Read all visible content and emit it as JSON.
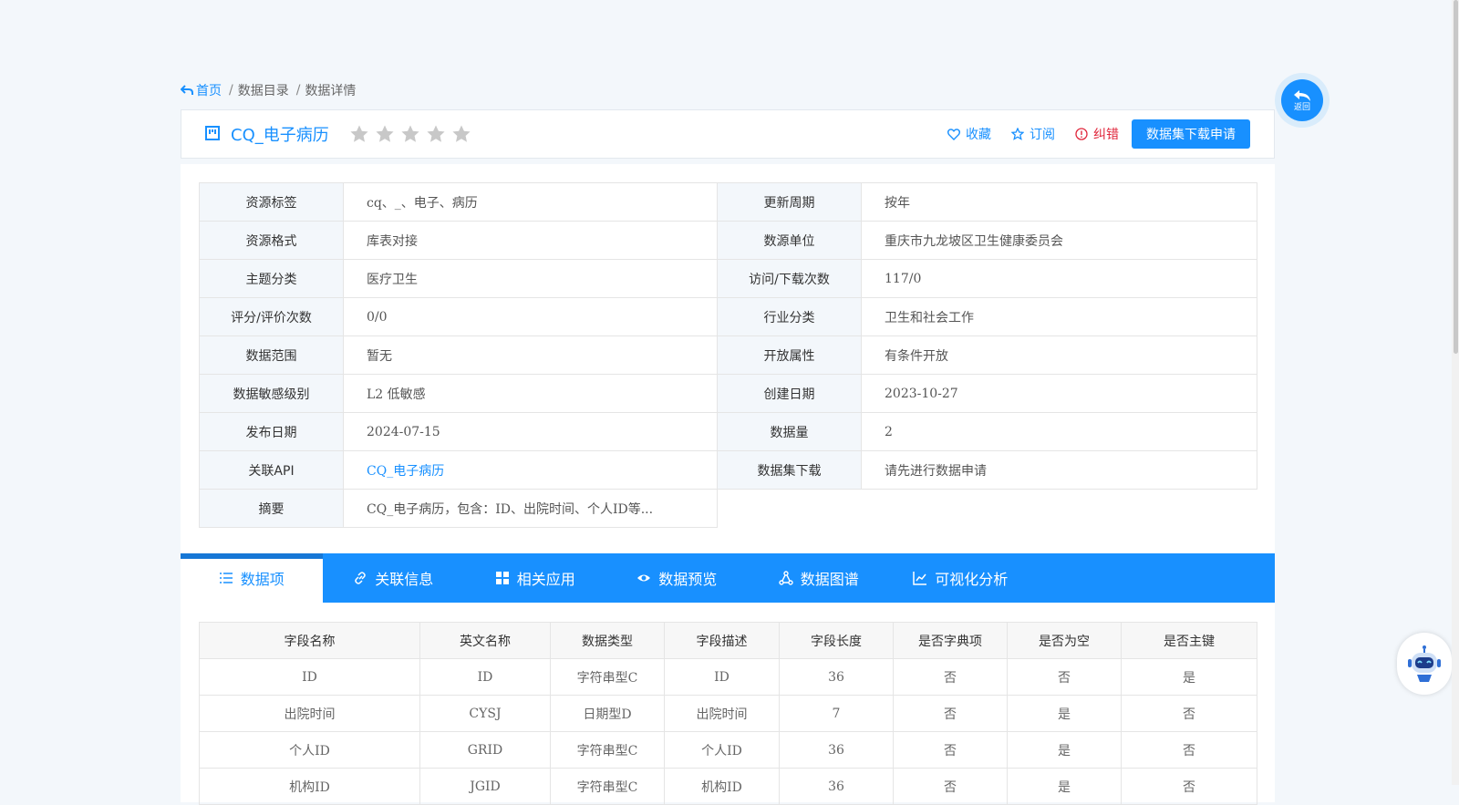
{
  "breadcrumb": {
    "home": "首页",
    "sep": "/",
    "items": [
      "数据目录",
      "数据详情"
    ]
  },
  "header": {
    "title": "CQ_电子病历",
    "rating_stars": 5,
    "rating_value": 0,
    "actions": {
      "favorite": "收藏",
      "subscribe": "订阅",
      "report_error": "纠错"
    },
    "apply_button": "数据集下载申请"
  },
  "info": {
    "rows": [
      [
        {
          "label": "资源标签",
          "value": "cq、_、电子、病历"
        },
        {
          "label": "更新周期",
          "value": "按年"
        }
      ],
      [
        {
          "label": "资源格式",
          "value": "库表对接"
        },
        {
          "label": "数源单位",
          "value": "重庆市九龙坡区卫生健康委员会"
        }
      ],
      [
        {
          "label": "主题分类",
          "value": "医疗卫生"
        },
        {
          "label": "访问/下载次数",
          "value": "117/0"
        }
      ],
      [
        {
          "label": "评分/评价次数",
          "value": "0/0"
        },
        {
          "label": "行业分类",
          "value": "卫生和社会工作"
        }
      ],
      [
        {
          "label": "数据范围",
          "value": "暂无"
        },
        {
          "label": "开放属性",
          "value": "有条件开放"
        }
      ],
      [
        {
          "label": "数据敏感级别",
          "value": "L2 低敏感"
        },
        {
          "label": "创建日期",
          "value": "2023-10-27"
        }
      ],
      [
        {
          "label": "发布日期",
          "value": "2024-07-15"
        },
        {
          "label": "数据量",
          "value": "2"
        }
      ],
      [
        {
          "label": "关联API",
          "value": "CQ_电子病历"
        },
        {
          "label": "数据集下载",
          "value": "请先进行数据申请"
        }
      ],
      [
        {
          "label": "摘要",
          "value": "CQ_电子病历，包含：ID、出院时间、个人ID等..."
        }
      ]
    ]
  },
  "tabs": [
    {
      "label": "数据项",
      "icon": "list-icon"
    },
    {
      "label": "关联信息",
      "icon": "link-icon"
    },
    {
      "label": "相关应用",
      "icon": "grid-icon"
    },
    {
      "label": "数据预览",
      "icon": "eye-icon"
    },
    {
      "label": "数据图谱",
      "icon": "graph-icon"
    },
    {
      "label": "可视化分析",
      "icon": "line-chart-icon"
    }
  ],
  "fields": {
    "headers": [
      "字段名称",
      "英文名称",
      "数据类型",
      "字段描述",
      "字段长度",
      "是否字典项",
      "是否为空",
      "是否主键"
    ],
    "rows": [
      [
        "ID",
        "ID",
        "字符串型C",
        "ID",
        "36",
        "否",
        "否",
        "是"
      ],
      [
        "出院时间",
        "CYSJ",
        "日期型D",
        "出院时间",
        "7",
        "否",
        "是",
        "否"
      ],
      [
        "个人ID",
        "GRID",
        "字符串型C",
        "个人ID",
        "36",
        "否",
        "是",
        "否"
      ],
      [
        "机构ID",
        "JGID",
        "字符串型C",
        "机构ID",
        "36",
        "否",
        "是",
        "否"
      ]
    ]
  },
  "floating": {
    "return_label": "返回"
  },
  "colors": {
    "accent": "#1890ff",
    "error": "#e0263b",
    "star": "#c8c8c8"
  }
}
